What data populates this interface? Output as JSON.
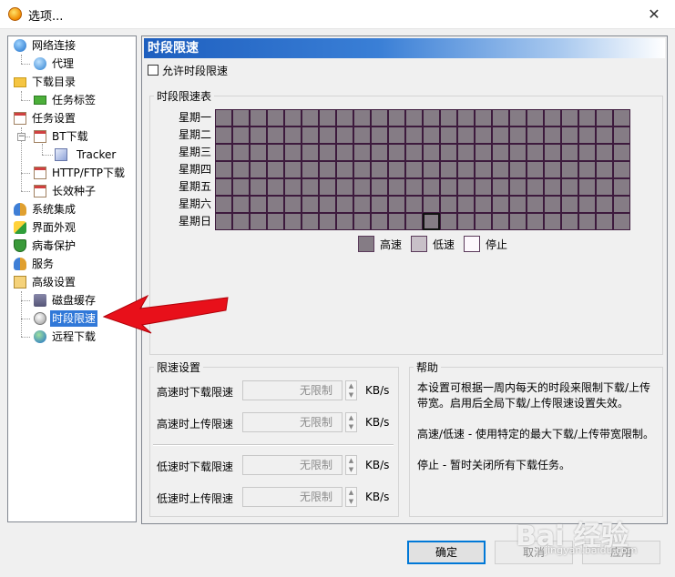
{
  "window": {
    "title": "选项...",
    "close_glyph": "✕"
  },
  "tree": {
    "items": [
      {
        "label": "网络连接",
        "icon": "globe-network-icon"
      },
      {
        "label": "代理",
        "icon": "proxy-globe-icon"
      },
      {
        "label": "下载目录",
        "icon": "folder-icon"
      },
      {
        "label": "任务标签",
        "icon": "tag-icon"
      },
      {
        "label": "任务设置",
        "icon": "checklist-icon"
      },
      {
        "label": "BT下载",
        "icon": "checklist-icon"
      },
      {
        "label": "Tracker",
        "icon": "cube-icon"
      },
      {
        "label": "HTTP/FTP下载",
        "icon": "checklist-icon"
      },
      {
        "label": "长效种子",
        "icon": "checklist-icon"
      },
      {
        "label": "系统集成",
        "icon": "users-icon"
      },
      {
        "label": "界面外观",
        "icon": "paint-icon"
      },
      {
        "label": "病毒保护",
        "icon": "shield-icon"
      },
      {
        "label": "服务",
        "icon": "users-icon"
      },
      {
        "label": "高级设置",
        "icon": "advanced-settings-icon"
      },
      {
        "label": "磁盘缓存",
        "icon": "disk-cache-icon"
      },
      {
        "label": "时段限速",
        "icon": "time-limit-icon"
      },
      {
        "label": "远程下载",
        "icon": "remote-globe-icon"
      }
    ],
    "bt_expander": "−"
  },
  "panel": {
    "title": "时段限速",
    "enable_checkbox_label": "允许时段限速",
    "schedule": {
      "group_label": "时段限速表",
      "days": [
        "星期一",
        "星期二",
        "星期三",
        "星期四",
        "星期五",
        "星期六",
        "星期日"
      ],
      "hour_columns": 24,
      "all_cells_state": "高速",
      "current_cell": {
        "day": "星期日",
        "hour": 12
      },
      "legend": [
        {
          "label": "高速",
          "color": "#857c85"
        },
        {
          "label": "低速",
          "color": "#c8c0c8"
        },
        {
          "label": "停止",
          "color": "#fdf8fd"
        }
      ]
    },
    "speed": {
      "group_label": "限速设置",
      "rows": [
        {
          "label": "高速时下载限速",
          "value": "无限制",
          "unit": "KB/s"
        },
        {
          "label": "高速时上传限速",
          "value": "无限制",
          "unit": "KB/s"
        },
        {
          "label": "低速时下载限速",
          "value": "无限制",
          "unit": "KB/s"
        },
        {
          "label": "低速时上传限速",
          "value": "无限制",
          "unit": "KB/s"
        }
      ]
    },
    "help": {
      "group_label": "帮助",
      "paragraphs": [
        "本设置可根据一周内每天的时段来限制下载/上传带宽。启用后全局下载/上传限速设置失效。",
        "高速/低速 - 使用特定的最大下载/上传带宽限制。",
        "停止 - 暂时关闭所有下载任务。"
      ]
    }
  },
  "buttons": {
    "ok": "确定",
    "cancel": "取消",
    "apply": "应用"
  },
  "watermark": "Bai 经验",
  "watermark_sub": "jingyan.baidu.com",
  "colors": {
    "header_gradient_start": "#1e5fbf",
    "selection": "#3078d8",
    "arrow": "#e8101a"
  }
}
